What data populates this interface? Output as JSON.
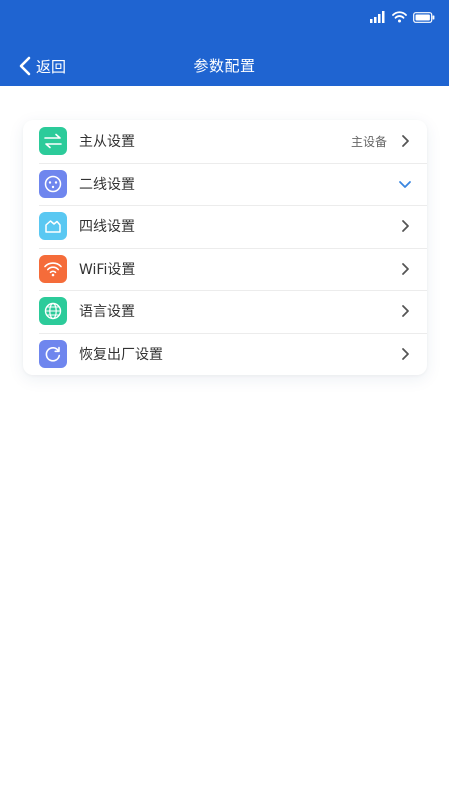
{
  "header": {
    "back_label": "返回",
    "title": "参数配置",
    "color": "#1f64d1"
  },
  "settings": {
    "items": [
      {
        "label": "主从设置",
        "value": "主设备",
        "icon": "swap-arrows-icon",
        "icon_color": "#2ccb9a",
        "indicator": "chevron-right"
      },
      {
        "label": "二线设置",
        "value": "",
        "icon": "socket-icon",
        "icon_color": "#6f86ee",
        "indicator": "chevron-down"
      },
      {
        "label": "四线设置",
        "value": "",
        "icon": "house-icon",
        "icon_color": "#5ac8f2",
        "indicator": "chevron-right"
      },
      {
        "label": "WiFi设置",
        "value": "",
        "icon": "wifi-icon",
        "icon_color": "#f56c3a",
        "indicator": "chevron-right"
      },
      {
        "label": "语言设置",
        "value": "",
        "icon": "globe-icon",
        "icon_color": "#2ccb9a",
        "indicator": "chevron-right"
      },
      {
        "label": "恢复出厂设置",
        "value": "",
        "icon": "refresh-icon",
        "icon_color": "#6f86ee",
        "indicator": "chevron-right"
      }
    ]
  }
}
